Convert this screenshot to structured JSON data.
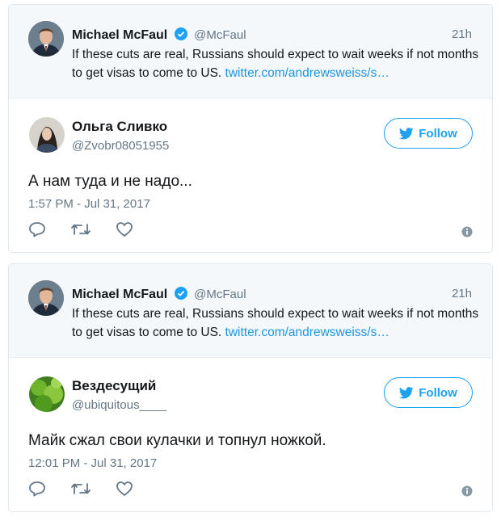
{
  "threads": [
    {
      "quoted": {
        "name": "Michael McFaul",
        "handle": "@McFaul",
        "time": "21h",
        "text": "If these cuts are real, Russians should expect to wait weeks if not months to get visas to come to US.",
        "link": "twitter.com/andrewsweiss/s…"
      },
      "reply": {
        "name": "Ольга Сливко",
        "handle": "@Zvobr08051955",
        "follow_label": "Follow",
        "text": "А нам туда и не надо...",
        "date": "1:57 PM - Jul 31, 2017"
      }
    },
    {
      "quoted": {
        "name": "Michael McFaul",
        "handle": "@McFaul",
        "time": "21h",
        "text": "If these cuts are real, Russians should expect to wait weeks if not months to get visas to come to US.",
        "link": "twitter.com/andrewsweiss/s…"
      },
      "reply": {
        "name": "Вездесущий",
        "handle": "@ubiquitous____",
        "follow_label": "Follow",
        "text": "Майк сжал свои кулачки и топнул ножкой.",
        "date": "12:01 PM - Jul 31, 2017"
      }
    }
  ],
  "colors": {
    "accent": "#1da1f2",
    "link": "#1b95e0",
    "secondary_text": "#657786",
    "quoted_bg": "#f5f8fa"
  },
  "icons": [
    "verified-badge-icon",
    "twitter-bird-icon",
    "reply-icon",
    "retweet-icon",
    "like-icon",
    "info-icon"
  ]
}
